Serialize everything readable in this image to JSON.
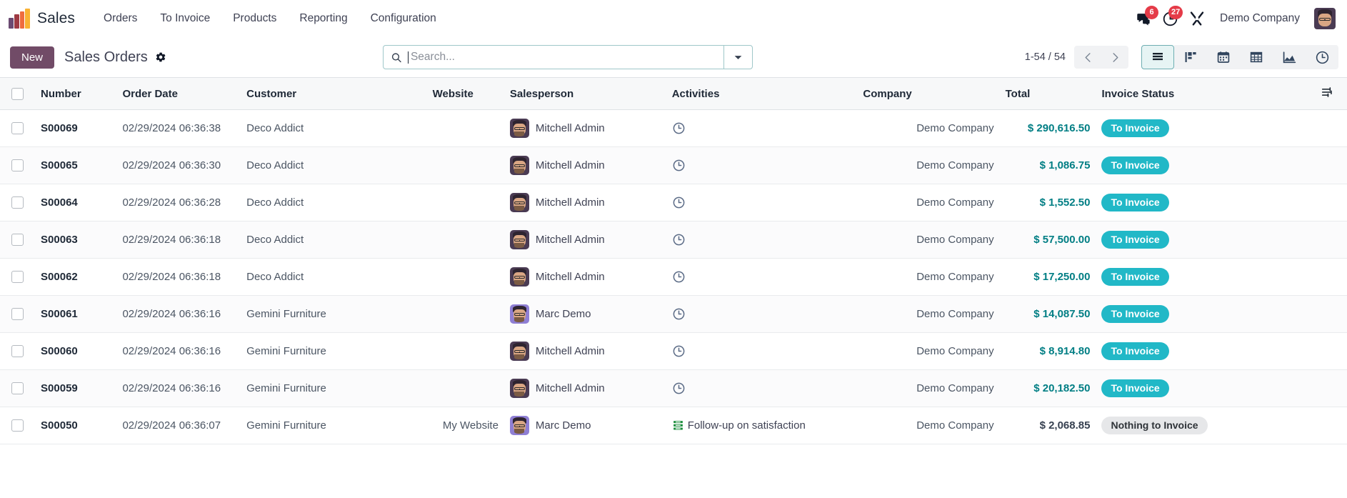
{
  "navbar": {
    "logo_icon": "odoo-bars-logo",
    "brand": "Sales",
    "menu": [
      {
        "label": "Orders"
      },
      {
        "label": "To Invoice"
      },
      {
        "label": "Products"
      },
      {
        "label": "Reporting"
      },
      {
        "label": "Configuration"
      }
    ],
    "messages_icon": "chat-bubble-icon",
    "messages_count": "6",
    "activities_icon": "clock-icon",
    "activities_count": "27",
    "debug_icon": "tools-icon",
    "company": "Demo Company",
    "avatar_icon": "user-avatar"
  },
  "control_panel": {
    "new_label": "New",
    "title": "Sales Orders",
    "settings_icon": "gear-icon",
    "search": {
      "icon": "search-icon",
      "placeholder": "Search...",
      "value": "",
      "dropdown_icon": "chevron-down-icon"
    },
    "pager": {
      "range": "1-54 / 54",
      "prev_icon": "chevron-left-icon",
      "next_icon": "chevron-right-icon"
    },
    "views": [
      {
        "name": "list",
        "icon": "list-icon",
        "active": true
      },
      {
        "name": "kanban",
        "icon": "kanban-icon",
        "active": false
      },
      {
        "name": "calendar",
        "icon": "calendar-icon",
        "active": false
      },
      {
        "name": "pivot",
        "icon": "pivot-icon",
        "active": false
      },
      {
        "name": "graph",
        "icon": "graph-icon",
        "active": false
      },
      {
        "name": "activity",
        "icon": "activity-clock-icon",
        "active": false
      }
    ]
  },
  "table": {
    "columns": [
      "Number",
      "Order Date",
      "Customer",
      "Website",
      "Salesperson",
      "Activities",
      "Company",
      "Total",
      "Invoice Status"
    ],
    "options_icon": "column-options-icon",
    "rows": [
      {
        "number": "S00069",
        "date": "02/29/2024 06:36:38",
        "customer": "Deco Addict",
        "website": "",
        "salesperson": "Mitchell Admin",
        "salesperson_avatar": "av-mitchell",
        "activity_icon": "clock-icon",
        "activity_label": "",
        "company": "Demo Company",
        "total": "$ 290,616.50",
        "total_style": "teal",
        "status": "To Invoice",
        "status_style": "toinvoice"
      },
      {
        "number": "S00065",
        "date": "02/29/2024 06:36:30",
        "customer": "Deco Addict",
        "website": "",
        "salesperson": "Mitchell Admin",
        "salesperson_avatar": "av-mitchell",
        "activity_icon": "clock-icon",
        "activity_label": "",
        "company": "Demo Company",
        "total": "$ 1,086.75",
        "total_style": "teal",
        "status": "To Invoice",
        "status_style": "toinvoice"
      },
      {
        "number": "S00064",
        "date": "02/29/2024 06:36:28",
        "customer": "Deco Addict",
        "website": "",
        "salesperson": "Mitchell Admin",
        "salesperson_avatar": "av-mitchell",
        "activity_icon": "clock-icon",
        "activity_label": "",
        "company": "Demo Company",
        "total": "$ 1,552.50",
        "total_style": "teal",
        "status": "To Invoice",
        "status_style": "toinvoice"
      },
      {
        "number": "S00063",
        "date": "02/29/2024 06:36:18",
        "customer": "Deco Addict",
        "website": "",
        "salesperson": "Mitchell Admin",
        "salesperson_avatar": "av-mitchell",
        "activity_icon": "clock-icon",
        "activity_label": "",
        "company": "Demo Company",
        "total": "$ 57,500.00",
        "total_style": "teal",
        "status": "To Invoice",
        "status_style": "toinvoice"
      },
      {
        "number": "S00062",
        "date": "02/29/2024 06:36:18",
        "customer": "Deco Addict",
        "website": "",
        "salesperson": "Mitchell Admin",
        "salesperson_avatar": "av-mitchell",
        "activity_icon": "clock-icon",
        "activity_label": "",
        "company": "Demo Company",
        "total": "$ 17,250.00",
        "total_style": "teal",
        "status": "To Invoice",
        "status_style": "toinvoice"
      },
      {
        "number": "S00061",
        "date": "02/29/2024 06:36:16",
        "customer": "Gemini Furniture",
        "website": "",
        "salesperson": "Marc Demo",
        "salesperson_avatar": "av-marc",
        "activity_icon": "clock-icon",
        "activity_label": "",
        "company": "Demo Company",
        "total": "$ 14,087.50",
        "total_style": "teal",
        "status": "To Invoice",
        "status_style": "toinvoice"
      },
      {
        "number": "S00060",
        "date": "02/29/2024 06:36:16",
        "customer": "Gemini Furniture",
        "website": "",
        "salesperson": "Mitchell Admin",
        "salesperson_avatar": "av-mitchell",
        "activity_icon": "clock-icon",
        "activity_label": "",
        "company": "Demo Company",
        "total": "$ 8,914.80",
        "total_style": "teal",
        "status": "To Invoice",
        "status_style": "toinvoice"
      },
      {
        "number": "S00059",
        "date": "02/29/2024 06:36:16",
        "customer": "Gemini Furniture",
        "website": "",
        "salesperson": "Mitchell Admin",
        "salesperson_avatar": "av-mitchell",
        "activity_icon": "clock-icon",
        "activity_label": "",
        "company": "Demo Company",
        "total": "$ 20,182.50",
        "total_style": "teal",
        "status": "To Invoice",
        "status_style": "toinvoice"
      },
      {
        "number": "S00050",
        "date": "02/29/2024 06:36:07",
        "customer": "Gemini Furniture",
        "website": "My Website",
        "salesperson": "Marc Demo",
        "salesperson_avatar": "av-marc",
        "activity_icon": "green-list-icon",
        "activity_label": "Follow-up on satisfaction",
        "company": "Demo Company",
        "total": "$ 2,068.85",
        "total_style": "plain",
        "status": "Nothing to Invoice",
        "status_style": "nothing"
      }
    ]
  },
  "colors": {
    "brand_purple": "#714B67",
    "accent_teal": "#017E84",
    "badge_cyan": "#21B8C7",
    "badge_grey": "#E6E7E9",
    "badge_red": "#E53B48"
  }
}
